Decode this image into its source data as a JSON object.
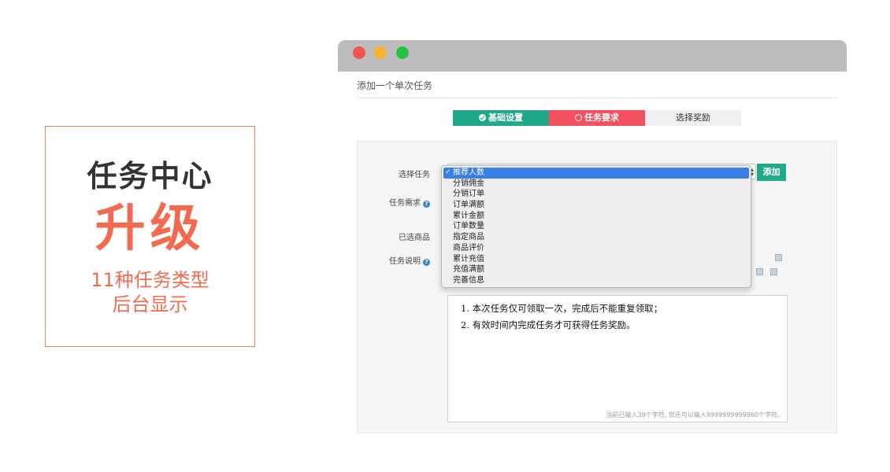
{
  "promo": {
    "title": "任务中心",
    "highlight": "升级",
    "line1": "11种任务类型",
    "line2": "后台显示"
  },
  "window": {
    "page_title": "添加一个单次任务",
    "steps": [
      {
        "label": "基础设置",
        "state": "done",
        "color": "#1fa88a"
      },
      {
        "label": "任务要求",
        "state": "current",
        "color": "#f3515f"
      },
      {
        "label": "选择奖励",
        "state": "pending",
        "color": "#f0f0f0"
      }
    ],
    "form": {
      "select_task_label": "选择任务",
      "task_requirement_label": "任务需求",
      "selected_goods_label": "已选商品",
      "task_desc_label": "任务说明",
      "add_button": "添加",
      "task_options": [
        "推荐人数",
        "分销佣金",
        "分销订单",
        "订单满额",
        "累计金额",
        "订单数量",
        "指定商品",
        "商品评价",
        "累计充值",
        "充值满额",
        "完善信息"
      ],
      "selected_option": "推荐人数",
      "description_lines": [
        "1. 本次任务仅可领取一次，完成后不能重复领取；",
        "2. 有效时间内完成任务才可获得任务奖励。"
      ],
      "char_counter": "当前已输入39个字符, 您还可以输入9999999999960个字符。"
    }
  },
  "icons": {
    "help": "question-circle-icon",
    "check": "check-circle-icon",
    "circle": "circle-outline-icon"
  }
}
